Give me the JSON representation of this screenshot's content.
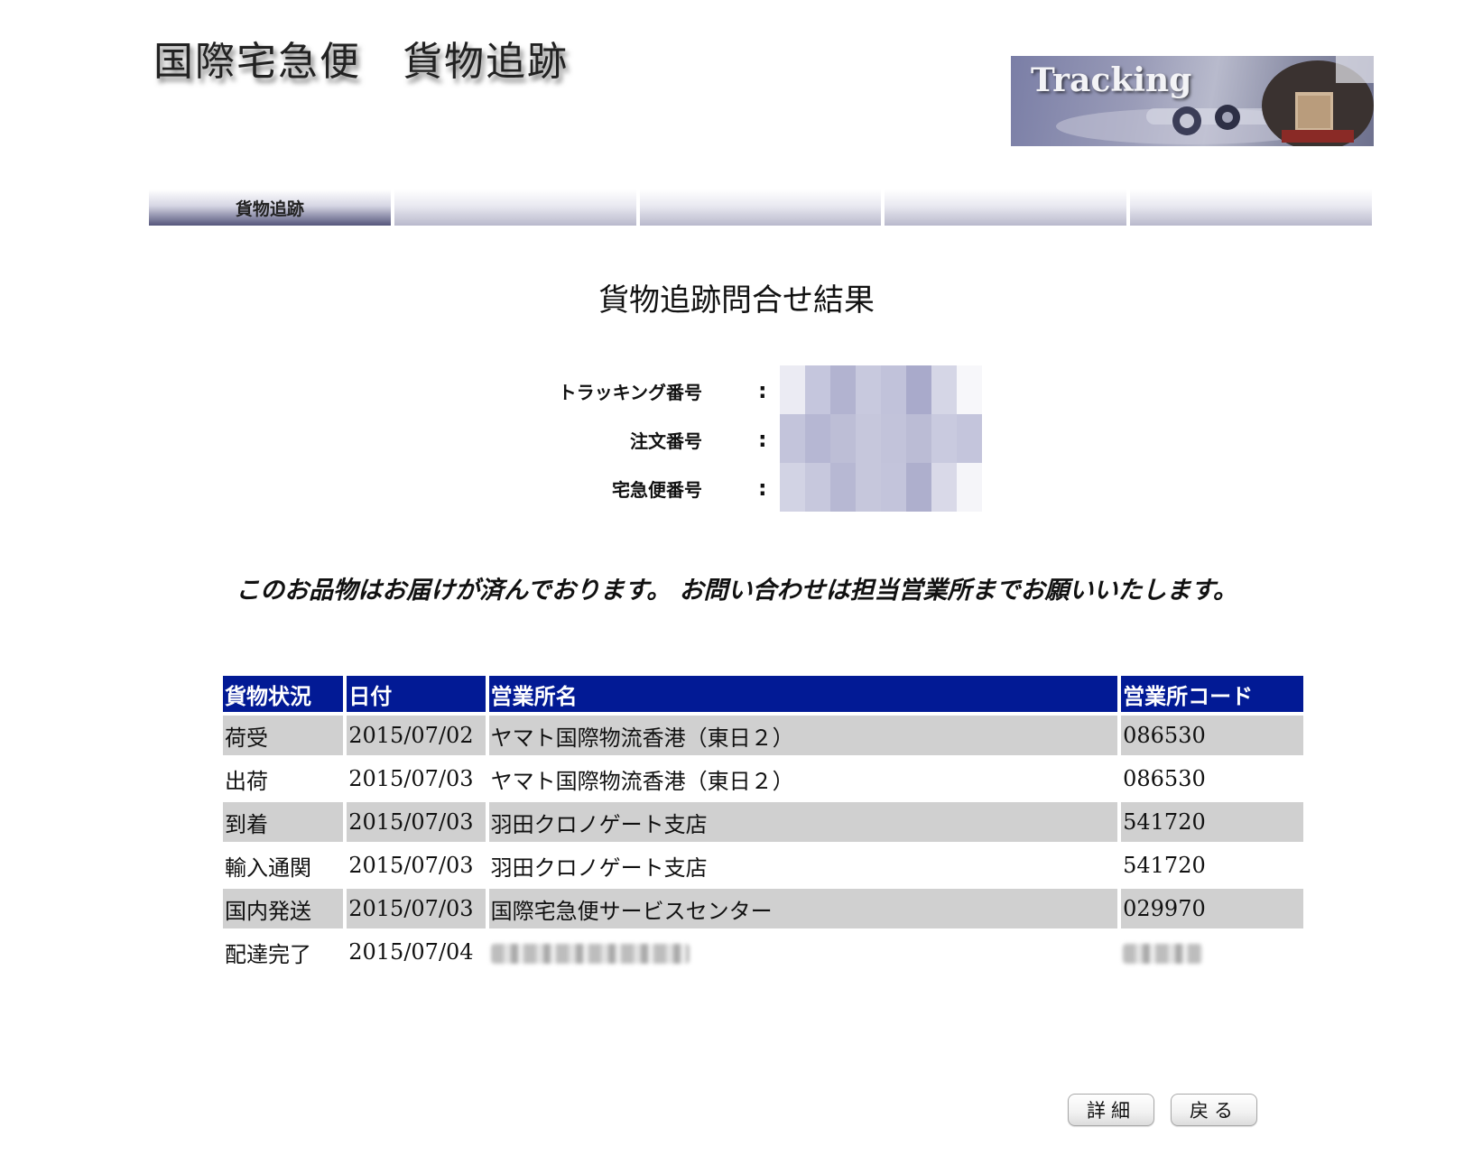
{
  "header": {
    "site_title": "国際宅急便　貨物追跡",
    "banner_text": "Tracking"
  },
  "nav": {
    "tabs": [
      {
        "label": "貨物追跡",
        "active": true
      },
      {
        "label": "",
        "active": false
      },
      {
        "label": "",
        "active": false
      },
      {
        "label": "",
        "active": false
      },
      {
        "label": "",
        "active": false
      }
    ]
  },
  "page_title": "貨物追跡問合せ結果",
  "info": {
    "colon": ":",
    "rows": [
      {
        "label": "トラッキング番号",
        "value": ""
      },
      {
        "label": "注文番号",
        "value": ""
      },
      {
        "label": "宅急便番号",
        "value": ""
      }
    ]
  },
  "notice": "このお品物はお届けが済んでおります。 お問い合わせは担当営業所までお願いいたします。",
  "table": {
    "headers": [
      "貨物状況",
      "日付",
      "営業所名",
      "営業所コード"
    ],
    "rows": [
      [
        "荷受",
        "2015/07/02",
        "ヤマト国際物流香港（東日２）",
        "086530"
      ],
      [
        "出荷",
        "2015/07/03",
        "ヤマト国際物流香港（東日２）",
        "086530"
      ],
      [
        "到着",
        "2015/07/03",
        "羽田クロノゲート支店",
        "541720"
      ],
      [
        "輸入通関",
        "2015/07/03",
        "羽田クロノゲート支店",
        "541720"
      ],
      [
        "国内発送",
        "2015/07/03",
        "国際宅急便サービスセンター",
        "029970"
      ],
      [
        "配達完了",
        "2015/07/04",
        "",
        ""
      ]
    ]
  },
  "buttons": {
    "detail": "詳細",
    "back": "戻る"
  },
  "colors": {
    "table_header_bg": "#021a95",
    "row_shade": "#d0d0d0",
    "mosaic": "#b5b6d2"
  }
}
